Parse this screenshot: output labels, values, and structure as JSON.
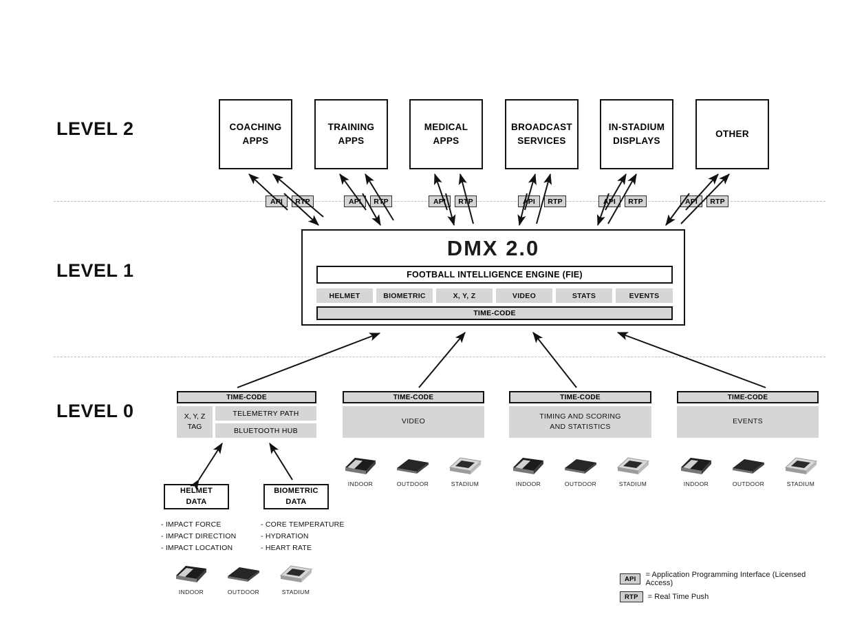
{
  "levels": [
    {
      "id": "level-2",
      "label": "LEVEL 2"
    },
    {
      "id": "level-1",
      "label": "LEVEL 1"
    },
    {
      "id": "level-0",
      "label": "LEVEL 0"
    }
  ],
  "apps": [
    {
      "line1": "COACHING",
      "line2": "APPS"
    },
    {
      "line1": "TRAINING",
      "line2": "APPS"
    },
    {
      "line1": "MEDICAL",
      "line2": "APPS"
    },
    {
      "line1": "BROADCAST",
      "line2": "SERVICES"
    },
    {
      "line1": "IN-STADIUM",
      "line2": "DISPLAYS"
    },
    {
      "line1": "OTHER",
      "line2": ""
    }
  ],
  "protocols": {
    "api": "API",
    "rtp": "RTP"
  },
  "dmx": {
    "title": "DMX 2.0",
    "engine": "FOOTBALL INTELLIGENCE ENGINE (FIE)",
    "chips": [
      "HELMET",
      "BIOMETRIC",
      "X, Y, Z",
      "VIDEO",
      "STATS",
      "EVENTS"
    ],
    "timecode": "TIME-CODE"
  },
  "level0": {
    "timecode": "TIME-CODE",
    "groups": [
      {
        "name": "telemetry",
        "left": "X, Y, Z\nTAG",
        "left_line1": "X, Y, Z",
        "left_line2": "TAG",
        "sub": [
          "TELEMETRY PATH",
          "BLUETOOTH HUB"
        ]
      },
      {
        "name": "video",
        "body": "VIDEO"
      },
      {
        "name": "timing",
        "body_line1": "TIMING AND SCORING",
        "body_line2": "AND STATISTICS"
      },
      {
        "name": "events",
        "body": "EVENTS"
      }
    ]
  },
  "data_sources": [
    {
      "title_line1": "HELMET",
      "title_line2": "DATA",
      "bullets": [
        "- IMPACT FORCE",
        "- IMPACT DIRECTION",
        "- IMPACT LOCATION"
      ]
    },
    {
      "title_line1": "BIOMETRIC",
      "title_line2": "DATA",
      "bullets": [
        "- CORE TEMPERATURE",
        "- HYDRATION",
        "- HEART RATE"
      ]
    }
  ],
  "device_captions": [
    "INDOOR",
    "OUTDOOR",
    "STADIUM"
  ],
  "legend": [
    {
      "chip": "API",
      "text": "= Application Programming Interface (Licensed Access)"
    },
    {
      "chip": "RTP",
      "text": "= Real Time Push"
    }
  ],
  "colors": {
    "ink": "#111111",
    "gray_fill": "#d6d6d6",
    "chip_fill": "#d4d4d4",
    "divider": "#bdbdbd"
  }
}
